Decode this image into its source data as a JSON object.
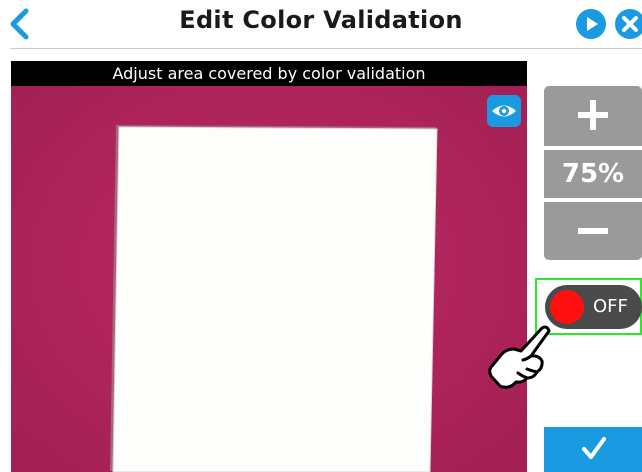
{
  "header": {
    "title": "Edit Color Validation",
    "back_icon": "chevron-left-icon",
    "play_icon": "play-circle-icon",
    "close_icon": "close-circle-icon"
  },
  "camera": {
    "caption": "Adjust area covered by color validation",
    "visibility_icon": "eye-icon"
  },
  "zoom": {
    "plus_icon": "plus-icon",
    "level": "75%",
    "minus_icon": "minus-icon"
  },
  "toggle": {
    "state": "OFF",
    "knob_color": "#ff1010"
  },
  "confirm": {
    "icon": "checkmark-icon"
  },
  "colors": {
    "accent": "#1a9ae0",
    "highlight": "#2ee72e",
    "camera_background": "#b0225a",
    "zoom_panel": "#9a9a9a"
  }
}
